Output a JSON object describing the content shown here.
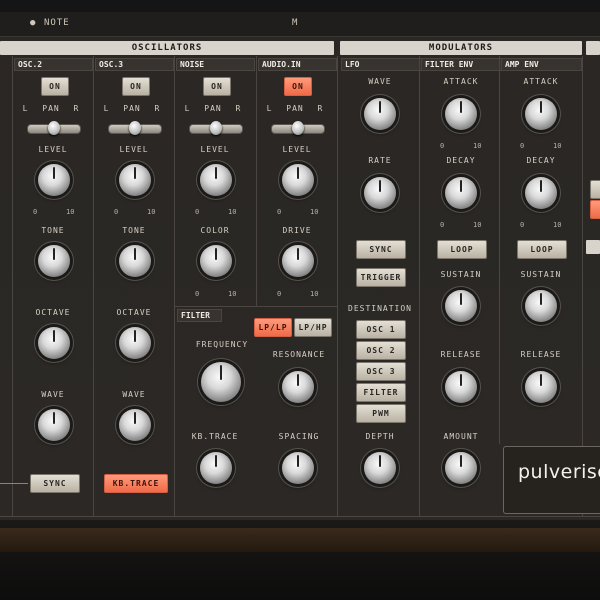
{
  "topbar": {
    "note": "NOTE",
    "m": "M"
  },
  "sections": {
    "oscillators": "OSCILLATORS",
    "modulators": "MODULATORS",
    "filter": "FILTER"
  },
  "columns": {
    "osc2": "OSC.2",
    "osc3": "OSC.3",
    "noise": "NOISE",
    "audio_in": "AUDIO.IN",
    "lfo": "LFO",
    "filter_env": "FILTER ENV",
    "amp_env": "AMP ENV"
  },
  "labels": {
    "l": "L",
    "pan": "PAN",
    "r": "R",
    "level": "LEVEL",
    "tone": "TONE",
    "octave": "OCTAVE",
    "wave": "WAVE",
    "color": "COLOR",
    "drive": "DRIVE",
    "rate": "RATE",
    "attack": "ATTACK",
    "decay": "DECAY",
    "sustain": "SUSTAIN",
    "release": "RELEASE",
    "amount": "AMOUNT",
    "frequency": "FREQUENCY",
    "resonance": "RESONANCE",
    "kb_trace": "KB.TRACE",
    "spacing": "SPACING",
    "destination": "DESTINATION",
    "depth": "DEPTH",
    "zero": "0",
    "ten": "10"
  },
  "buttons": {
    "on": "ON",
    "sync": "SYNC",
    "trigger": "TRIGGER",
    "loop": "LOOP",
    "kb_trace": "KB.TRACE",
    "lp_lp": "LP/LP",
    "lp_hp": "LP/HP",
    "dest": [
      "OSC 1",
      "OSC 2",
      "OSC 3",
      "FILTER",
      "PWM"
    ]
  },
  "brand": {
    "name": "pulverise"
  }
}
